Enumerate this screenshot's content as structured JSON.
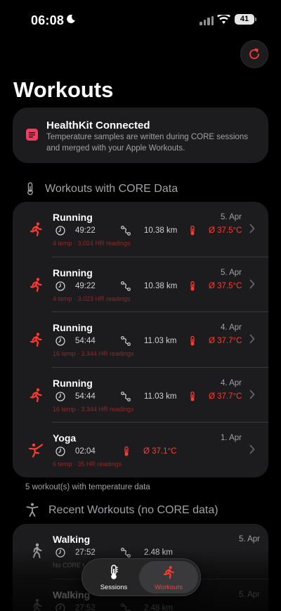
{
  "status": {
    "time": "06:08",
    "battery": "41"
  },
  "page": {
    "title": "Workouts"
  },
  "healthkit": {
    "title": "HealthKit Connected",
    "description": "Temperature samples are written during CORE sessions and merged with your Apple Workouts."
  },
  "core_section": {
    "header": "Workouts with CORE Data",
    "workouts": [
      {
        "type": "Running",
        "date": "5. Apr",
        "duration": "49:22",
        "distance": "10.38 km",
        "temp": "Ø 37.5°C",
        "sub": "4 temp · 3.024 HR readings",
        "icon": "running-icon"
      },
      {
        "type": "Running",
        "date": "5. Apr",
        "duration": "49:22",
        "distance": "10.38 km",
        "temp": "Ø 37.5°C",
        "sub": "4 temp · 3.023 HR readings",
        "icon": "running-icon"
      },
      {
        "type": "Running",
        "date": "4. Apr",
        "duration": "54:44",
        "distance": "11.03 km",
        "temp": "Ø 37.7°C",
        "sub": "16 temp · 3.344 HR readings",
        "icon": "running-icon"
      },
      {
        "type": "Running",
        "date": "4. Apr",
        "duration": "54:44",
        "distance": "11.03 km",
        "temp": "Ø 37.7°C",
        "sub": "16 temp · 3.344 HR readings",
        "icon": "running-icon"
      },
      {
        "type": "Yoga",
        "date": "1. Apr",
        "duration": "02:04",
        "distance": "",
        "temp": "Ø 37.1°C",
        "sub": "6 temp · 35 HR readings",
        "icon": "yoga-icon"
      }
    ],
    "footer": "5 workout(s) with temperature data"
  },
  "recent_section": {
    "header": "Recent Workouts (no CORE data)",
    "workouts": [
      {
        "type": "Walking",
        "date": "5. Apr",
        "duration": "27:52",
        "distance": "2.48 km",
        "sub": "No CORE t"
      },
      {
        "type": "Walking",
        "date": "5. Apr",
        "duration": "27:52",
        "distance": "2.48 km",
        "sub": ""
      }
    ]
  },
  "tabbar": {
    "tabs": [
      {
        "label": "Sessions",
        "icon": "thermometer-icon",
        "active": false
      },
      {
        "label": "Workouts",
        "icon": "running-icon",
        "active": true
      }
    ]
  },
  "colors": {
    "accent": "#ff3b30",
    "card": "#1c1c1e",
    "background": "#000000",
    "healthkit_icon": "#ff375f"
  }
}
